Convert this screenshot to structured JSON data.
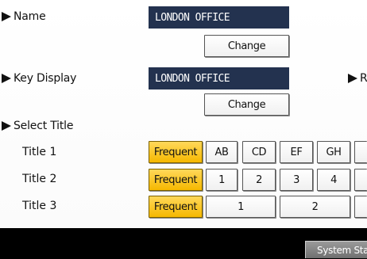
{
  "name": {
    "label": "Name",
    "value": "LONDON OFFICE",
    "change_label": "Change"
  },
  "key_display": {
    "label": "Key Display",
    "value": "LONDON OFFICE",
    "change_label": "Change",
    "right_label_partial": "R"
  },
  "select_title": {
    "label": "Select Title",
    "rows": [
      {
        "title": "Title 1",
        "frequent": "Frequent",
        "options": [
          "AB",
          "CD",
          "EF",
          "GH"
        ]
      },
      {
        "title": "Title 2",
        "frequent": "Frequent",
        "options": [
          "1",
          "2",
          "3",
          "4"
        ]
      },
      {
        "title": "Title 3",
        "frequent": "Frequent",
        "options": [
          "1",
          "2"
        ]
      }
    ]
  },
  "footer": {
    "system_status": "System Statu"
  },
  "colors": {
    "field_bg": "#23324f",
    "frequent_bg": "#f5b800",
    "footer_bg": "#000000"
  }
}
